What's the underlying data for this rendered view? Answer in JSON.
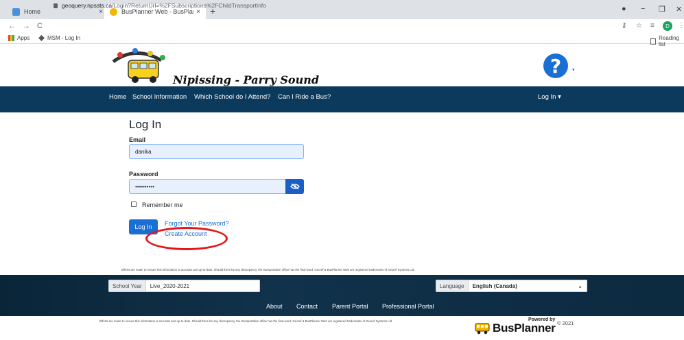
{
  "browser": {
    "tabs": [
      {
        "title": "Home",
        "close": "×"
      },
      {
        "title": "BusPlanner Web - BusPlanner We",
        "close": "×"
      }
    ],
    "new_tab": "+",
    "url_host": "geoquery.npssts.ca",
    "url_path": "/Login?ReturnUrl=%2FSubscriptions%2FChildTransportInfo",
    "profile_initial": "D",
    "bookmarks": [
      {
        "label": "Apps"
      },
      {
        "label": "MSM - Log In"
      }
    ],
    "reading_list": "Reading list",
    "colors": {
      "tabbar": "#dee1e6",
      "profile": "#1aa260"
    }
  },
  "header": {
    "logo_text": "Nipissing - Parry Sound",
    "help_symbol": "?",
    "help_caret": "▾"
  },
  "nav": {
    "items": [
      "Home",
      "School Information",
      "Which School do I Attend?",
      "Can I Ride a Bus?"
    ],
    "login": "Log In ▾",
    "color": "#0b3a5c"
  },
  "form": {
    "title": "Log In",
    "email_label": "Email",
    "email_value": "danika",
    "password_label": "Password",
    "password_value": "••••••••••",
    "remember_label": "Remember me",
    "login_button": "Log In",
    "forgot_link": "Forgot Your Password?",
    "create_link": "Create Account",
    "accent": "#1a6fd4"
  },
  "disclaimer": "Efforts are made to ensure this information is accurate and up-to-date. Should there be any discrepancy, the transportation office has the final word. Georef & BusPlanner Web are registered trademarks of Georef Systems Ltd.",
  "footer": {
    "school_year_label": "School Year",
    "school_year_value": "Live_2020-2021",
    "language_label": "Language",
    "language_value": "English (Canada)",
    "links": [
      "About",
      "Contact",
      "Parent Portal",
      "Professional Portal"
    ],
    "powered_by": "Powered by",
    "copyright": "© 2021",
    "brand": "BusPlanner"
  },
  "annotation": {
    "highlight_color": "#e4161b"
  }
}
